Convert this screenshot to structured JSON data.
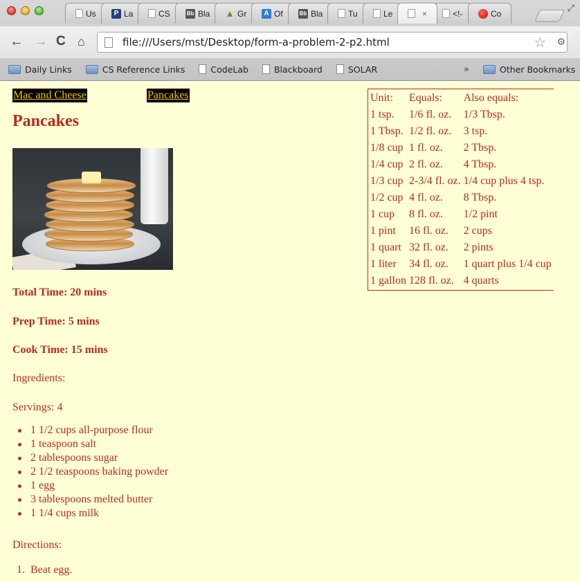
{
  "tabs": [
    {
      "label": "Us",
      "icon": "doc"
    },
    {
      "label": "La",
      "icon": "p"
    },
    {
      "label": "CS",
      "icon": "doc"
    },
    {
      "label": "Bla",
      "icon": "bb"
    },
    {
      "label": "Gr",
      "icon": "gr"
    },
    {
      "label": "Of",
      "icon": "a"
    },
    {
      "label": "Bla",
      "icon": "bb"
    },
    {
      "label": "Tu",
      "icon": "doc"
    },
    {
      "label": "Le",
      "icon": "doc"
    },
    {
      "label": "",
      "icon": "doc",
      "active": true
    },
    {
      "label": "<!-",
      "icon": "doc"
    },
    {
      "label": "Co",
      "icon": "co"
    }
  ],
  "toolbar": {
    "url": "file:///Users/mst/Desktop/form-a-problem-2-p2.html"
  },
  "bookmarks": {
    "items": [
      {
        "label": "Daily Links",
        "icon": "folder"
      },
      {
        "label": "CS Reference Links",
        "icon": "folder"
      },
      {
        "label": "CodeLab",
        "icon": "doc"
      },
      {
        "label": "Blackboard",
        "icon": "doc"
      },
      {
        "label": "SOLAR",
        "icon": "doc"
      }
    ],
    "overflow": "»",
    "other": "Other Bookmarks"
  },
  "page": {
    "nav": {
      "mac": "Mac and Cheese",
      "pancakes": "Pancakes"
    },
    "title": "Pancakes",
    "total_time": "Total Time: 20 mins",
    "prep_time": "Prep Time: 5 mins",
    "cook_time": "Cook Time: 15 mins",
    "ingredients_heading": "Ingredients:",
    "servings": "Servings: 4",
    "ingredients": [
      "1 1/2 cups all-purpose flour",
      "1 teaspoon salt",
      "2 tablespoons sugar",
      "2 1/2 teaspoons baking powder",
      "1 egg",
      "3 tablespoons melted butter",
      "1 1/4 cups milk"
    ],
    "directions_heading": "Directions:",
    "directions": [
      "Beat egg."
    ],
    "table": {
      "headers": [
        "Unit:",
        "Equals:",
        "Also equals:"
      ],
      "rows": [
        [
          "1 tsp.",
          "1/6 fl. oz.",
          "1/3 Tbsp."
        ],
        [
          "1 Tbsp.",
          "1/2 fl. oz.",
          "3 tsp."
        ],
        [
          "1/8 cup",
          "1 fl. oz.",
          "2 Tbsp."
        ],
        [
          "1/4 cup",
          "2 fl. oz.",
          "4 Tbsp."
        ],
        [
          "1/3 cup",
          "2-3/4 fl. oz.",
          "1/4 cup plus 4 tsp."
        ],
        [
          "1/2 cup",
          "4 fl. oz.",
          "8 Tbsp."
        ],
        [
          "1 cup",
          "8 fl. oz.",
          "1/2 pint"
        ],
        [
          "1 pint",
          "16 fl. oz.",
          "2 cups"
        ],
        [
          "1 quart",
          "32 fl. oz.",
          "2 pints"
        ],
        [
          "1 liter",
          "34 fl. oz.",
          "1 quart plus 1/4 cup"
        ],
        [
          "1 gallon",
          "128 fl. oz.",
          "4 quarts"
        ]
      ]
    }
  },
  "colors": {
    "page_bg": "#ffffd6",
    "text": "#b72a1d",
    "nav_bg": "#000000",
    "nav_text": "#f5c400"
  }
}
